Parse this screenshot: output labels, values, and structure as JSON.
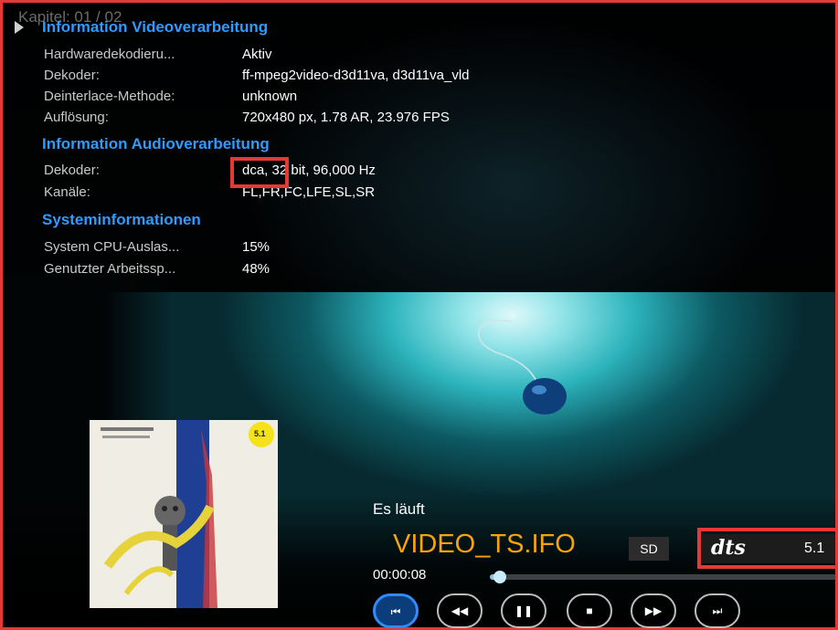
{
  "overlay": {
    "ghost_text": "Kapitel: 01 / 02",
    "sections": {
      "video": {
        "header": "Information Videoverarbeitung",
        "rows": [
          {
            "label": "Hardwaredekodieru...",
            "value": "Aktiv"
          },
          {
            "label": "Dekoder:",
            "value": "ff-mpeg2video-d3d11va, d3d11va_vld"
          },
          {
            "label": "Deinterlace-Methode:",
            "value": "unknown"
          },
          {
            "label": "Auflösung:",
            "value": "720x480 px, 1.78 AR, 23.976 FPS"
          }
        ]
      },
      "audio": {
        "header": "Information Audioverarbeitung",
        "rows": [
          {
            "label": "Dekoder:",
            "value": "dca, 32 bit, 96,000 Hz"
          },
          {
            "label": "Kanäle:",
            "value": "FL,FR,FC,LFE,SL,SR"
          }
        ]
      },
      "system": {
        "header": "Systeminformationen",
        "rows": [
          {
            "label": "System CPU-Auslas...",
            "value": "15%"
          },
          {
            "label": "Genutzter Arbeitssp...",
            "value": "48%"
          }
        ]
      }
    }
  },
  "player": {
    "status": "Es läuft",
    "title": "VIDEO_TS.IFO",
    "quality_badge": "SD",
    "audio_codec_logo": "dts",
    "channels": "5.1",
    "elapsed": "00:00:08",
    "progress_fraction": 0.02,
    "cover_badge": "5.1",
    "controls": [
      {
        "name": "previous-button",
        "icon": "skip-previous-icon",
        "glyph": "⏮",
        "active": true
      },
      {
        "name": "rewind-button",
        "icon": "rewind-icon",
        "glyph": "◀◀",
        "active": false
      },
      {
        "name": "pause-button",
        "icon": "pause-icon",
        "glyph": "❚❚",
        "active": false
      },
      {
        "name": "stop-button",
        "icon": "stop-icon",
        "glyph": "■",
        "active": false
      },
      {
        "name": "fast-forward-button",
        "icon": "fast-forward-icon",
        "glyph": "▶▶",
        "active": false
      },
      {
        "name": "next-button",
        "icon": "skip-next-icon",
        "glyph": "⏭",
        "active": false
      }
    ]
  },
  "colors": {
    "section_header": "#2f9bff",
    "title": "#f7a40c",
    "highlight_box": "#e53935",
    "active_button": "#2f8cff"
  }
}
